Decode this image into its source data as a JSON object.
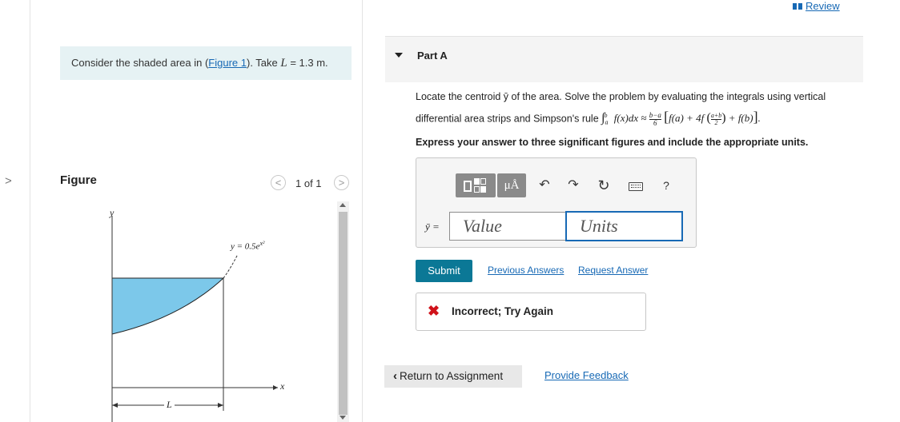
{
  "header": {
    "review_label": "Review"
  },
  "left_panel": {
    "collapse_arrow": ">",
    "problem_text_prefix": "Consider the shaded area in (",
    "figure_link": "Figure 1",
    "problem_text_middle": "). Take ",
    "problem_var": "L",
    "problem_value": " = 1.3 m.",
    "figure_title": "Figure",
    "figure_counter": "1 of 1",
    "prev_icon": "<",
    "next_icon": ">",
    "figure": {
      "y_axis": "y",
      "x_axis": "x",
      "length_label": "L",
      "curve_label_prefix": "y = 0.5e",
      "curve_label_exp": "x²"
    }
  },
  "part": {
    "title": "Part A",
    "instruction_line1": "Locate the centroid ȳ of the area. Solve the problem by evaluating the integrals using vertical",
    "instruction_line2_prefix": "differential area strips and Simpson's rule",
    "simpson_rule": "∫ₐᵇ f(x)dx ≈ (b−a)/6 [f(a) + 4f((a+b)/2) + f(b)]",
    "express": "Express your answer to three significant figures and include the appropriate units."
  },
  "toolbar": {
    "templates_icon": "templates-icon",
    "units_symbol": "μÅ",
    "undo": "↶",
    "redo": "↷",
    "reset": "↻",
    "keyboard_icon": "keyboard-icon",
    "help": "?"
  },
  "answer": {
    "variable_label": "ȳ =",
    "value_placeholder": "Value",
    "units_placeholder": "Units"
  },
  "actions": {
    "submit": "Submit",
    "previous_answers": "Previous Answers",
    "request_answer": "Request Answer"
  },
  "feedback": {
    "status": "Incorrect; Try Again",
    "status_color": "#d0121a"
  },
  "footer": {
    "return_label": "Return to Assignment",
    "provide_feedback": "Provide Feedback"
  },
  "colors": {
    "accent": "#1769b5",
    "submit_bg": "#0b7896",
    "problem_bg": "#e6f2f4",
    "shade": "#7cc8ea"
  }
}
